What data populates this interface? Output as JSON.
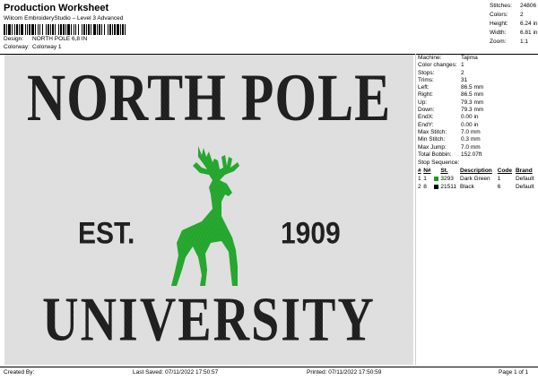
{
  "header": {
    "title": "Production Worksheet",
    "subtitle": "Wilcom EmbroideryStudio – Level 3 Advanced",
    "design_label": "Design:",
    "design_value": "NORTH POLE 6,8 IN",
    "colorway_label": "Colorway:",
    "colorway_value": "Colorway 1"
  },
  "summary": {
    "stitches_label": "Stitches:",
    "stitches_value": "24806",
    "colors_label": "Colors:",
    "colors_value": "2",
    "height_label": "Height:",
    "height_value": "6.24 in",
    "width_label": "Width:",
    "width_value": "6.81 in",
    "zoom_label": "Zoom:",
    "zoom_value": "1:1"
  },
  "design": {
    "line1": "NORTH POLE",
    "line2": "UNIVERSITY",
    "est": "EST.",
    "year": "1909",
    "thread_dark": "#1c1c1c",
    "thread_green": "#22a52b",
    "background": "#dedede"
  },
  "details": [
    {
      "label": "Machine:",
      "value": "Tajima"
    },
    {
      "label": "Color changes:",
      "value": "1"
    },
    {
      "label": "Stops:",
      "value": "2"
    },
    {
      "label": "Trims:",
      "value": "31"
    },
    {
      "label": "Left:",
      "value": "86.5 mm"
    },
    {
      "label": "Right:",
      "value": "86.5 mm"
    },
    {
      "label": "Up:",
      "value": "79.3 mm"
    },
    {
      "label": "Down:",
      "value": "79.3 mm"
    },
    {
      "label": "EndX:",
      "value": "0.00 in"
    },
    {
      "label": "EndY:",
      "value": "0.00 in"
    },
    {
      "label": "Max Stitch:",
      "value": "7.0 mm"
    },
    {
      "label": "Min Stitch:",
      "value": "0.3 mm"
    },
    {
      "label": "Max Jump:",
      "value": "7.0 mm"
    },
    {
      "label": "Total Bobbin:",
      "value": "152.07ft"
    }
  ],
  "stop_sequence": {
    "title": "Stop Sequence:",
    "headers": [
      "#",
      "N#",
      "",
      "St.",
      "Description",
      "Code",
      "Brand"
    ],
    "rows": [
      {
        "n": "1",
        "needle": "1",
        "color": "#1e9a1e",
        "st": "3293",
        "desc": "Dark Green",
        "code": "1",
        "brand": "Default"
      },
      {
        "n": "2",
        "needle": "8",
        "color": "#000000",
        "st": "21511",
        "desc": "Black",
        "code": "6",
        "brand": "Default"
      }
    ]
  },
  "footer": {
    "created": "Created By:",
    "saved": "Last Saved: 07/11/2022 17:50:57",
    "printed": "Printed: 07/11/2022 17:50:59",
    "page": "Page 1 of 1"
  }
}
